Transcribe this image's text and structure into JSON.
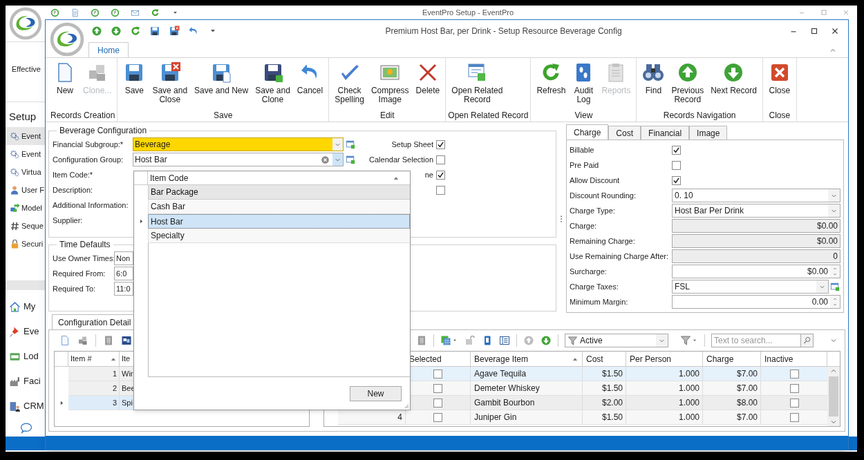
{
  "app_window": {
    "title": "EventPro Setup - EventPro",
    "field_label": "Effective",
    "section_title": "Setup",
    "nav_items": [
      {
        "label": "Event",
        "selected": true
      },
      {
        "label": "Event",
        "selected": false
      },
      {
        "label": "Virtua",
        "selected": false
      },
      {
        "label": "User F",
        "selected": false
      },
      {
        "label": "Model",
        "selected": false
      },
      {
        "label": "Seque",
        "selected": false
      },
      {
        "label": "Securi",
        "selected": false
      }
    ],
    "modules": [
      {
        "label": "My"
      },
      {
        "label": "Eve"
      },
      {
        "label": "Lod"
      },
      {
        "label": "Faci"
      },
      {
        "label": "CRM"
      }
    ]
  },
  "dialog": {
    "title": "Premium Host Bar, per Drink - Setup Resource Beverage Config",
    "ribbon_tabs": [
      {
        "label": "Home",
        "selected": true
      }
    ],
    "ribbon_groups": [
      {
        "label": "Records Creation",
        "buttons": [
          {
            "label": "New",
            "disabled": false
          },
          {
            "label": "Clone...",
            "disabled": true
          }
        ]
      },
      {
        "label": "Save",
        "buttons": [
          {
            "label": "Save",
            "disabled": false
          },
          {
            "label": "Save and\nClose",
            "disabled": false
          },
          {
            "label": "Save and New",
            "disabled": false
          },
          {
            "label": "Save and\nClone",
            "disabled": false
          },
          {
            "label": "Cancel",
            "disabled": false
          }
        ]
      },
      {
        "label": "Edit",
        "buttons": [
          {
            "label": "Check\nSpelling",
            "disabled": false
          },
          {
            "label": "Compress\nImage",
            "disabled": false
          },
          {
            "label": "Delete",
            "disabled": false
          }
        ]
      },
      {
        "label": "Open Related Record",
        "buttons": [
          {
            "label": "Open Related\nRecord",
            "disabled": false
          }
        ]
      },
      {
        "label": "View",
        "buttons": [
          {
            "label": "Refresh",
            "disabled": false
          },
          {
            "label": "Audit\nLog",
            "disabled": false
          },
          {
            "label": "Reports",
            "disabled": true
          }
        ]
      },
      {
        "label": "Records Navigation",
        "buttons": [
          {
            "label": "Find",
            "disabled": false
          },
          {
            "label": "Previous\nRecord",
            "disabled": false
          },
          {
            "label": "Next Record",
            "disabled": false
          }
        ]
      },
      {
        "label": "Close",
        "buttons": [
          {
            "label": "Close",
            "disabled": false
          }
        ]
      }
    ]
  },
  "beverage_configuration": {
    "title": "Beverage Configuration",
    "fields": [
      {
        "label": "Financial Subgroup:*",
        "kind": "lookup",
        "value": "Beverage",
        "highlighted": true,
        "open": false
      },
      {
        "label": "Configuration Group:",
        "kind": "lookup_clear",
        "value": "Host Bar",
        "highlighted": false,
        "open": true
      },
      {
        "label": "Item Code:*",
        "kind": "covered"
      },
      {
        "label": "Description:",
        "kind": "covered"
      },
      {
        "label": "Additional Information:",
        "kind": "covered"
      },
      {
        "label": "Supplier:",
        "kind": "covered"
      }
    ],
    "options": [
      {
        "label": "Setup Sheet",
        "checked": true
      },
      {
        "label": "Calendar Selection",
        "checked": false
      },
      {
        "label": "ne",
        "checked": true
      },
      {
        "checked": false
      }
    ]
  },
  "time_defaults": {
    "title": "Time Defaults",
    "fields": [
      {
        "label": "Use Owner Times:",
        "value": "Non"
      },
      {
        "label": "Required From:",
        "value": "6:0"
      },
      {
        "label": "Required To:",
        "value": "11:0"
      }
    ]
  },
  "charge_panel": {
    "tabs": [
      {
        "label": "Charge",
        "selected": true
      },
      {
        "label": "Cost",
        "selected": false
      },
      {
        "label": "Financial",
        "selected": false
      },
      {
        "label": "Image",
        "selected": false
      }
    ],
    "rows": [
      {
        "label": "Billable",
        "kind": "checkbox",
        "checked": true
      },
      {
        "label": "Pre Paid",
        "kind": "checkbox",
        "checked": false
      },
      {
        "label": "Allow Discount",
        "kind": "checkbox",
        "checked": true
      },
      {
        "label": "Discount Rounding:",
        "kind": "combo",
        "value": "0. 10"
      },
      {
        "label": "Charge Type:",
        "kind": "combo",
        "value": "Host Bar Per Drink"
      },
      {
        "label": "Charge:",
        "kind": "readonly",
        "value": "$0.00"
      },
      {
        "label": "Remaining Charge:",
        "kind": "readonly",
        "value": "$0.00"
      },
      {
        "label": "Use Remaining Charge After:",
        "kind": "readonly",
        "value": "0"
      },
      {
        "label": "Surcharge:",
        "kind": "spin",
        "value": "$0.00"
      },
      {
        "label": "Charge Taxes:",
        "kind": "lookup",
        "value": "FSL"
      },
      {
        "label": "Minimum Margin:",
        "kind": "spin",
        "value": "0.00"
      }
    ]
  },
  "detail_tabs": [
    {
      "label": "Configuration Detail",
      "selected": true
    }
  ],
  "items_grid": {
    "columns": [
      "Item #",
      "Ite"
    ],
    "rows": [
      {
        "number": "1",
        "item": "Wir",
        "selected": false
      },
      {
        "number": "2",
        "item": "Bee",
        "selected": false
      },
      {
        "number": "3",
        "item": "Spi",
        "selected": true
      }
    ]
  },
  "beverage_toolbar": {
    "filter": "Active",
    "search_placeholder": "Text to search..."
  },
  "beverage_grid": {
    "columns": [
      "Selected",
      "Beverage Item",
      "Cost",
      "Per Person",
      "Charge",
      "Inactive"
    ],
    "rows": [
      {
        "selected": true,
        "selected_column_checked": false,
        "item": "Agave Tequila",
        "cost": "$1.50",
        "per_person": "1.000",
        "charge": "$7.00",
        "inactive": false
      },
      {
        "selected": false,
        "selected_column_checked": false,
        "item": "Demeter Whiskey",
        "cost": "$1.50",
        "per_person": "1.000",
        "charge": "$7.00",
        "inactive": false
      },
      {
        "selected": false,
        "selected_column_checked": false,
        "item": "Gambit Bourbon",
        "cost": "$2.00",
        "per_person": "1.000",
        "charge": "$8.00",
        "inactive": false
      },
      {
        "number": "4",
        "selected": false,
        "selected_column_checked": false,
        "item": "Juniper Gin",
        "cost": "$1.50",
        "per_person": "1.000",
        "charge": "$7.00",
        "inactive": false
      }
    ]
  },
  "dropdown": {
    "column": "Item Code",
    "options": [
      {
        "label": "Bar Package",
        "selected": false,
        "hovered": true
      },
      {
        "label": "Cash Bar",
        "selected": false,
        "hovered": false
      },
      {
        "label": "Host Bar",
        "selected": true,
        "hovered": false
      },
      {
        "label": "Specialty",
        "selected": false,
        "hovered": false
      }
    ],
    "button": "New"
  }
}
